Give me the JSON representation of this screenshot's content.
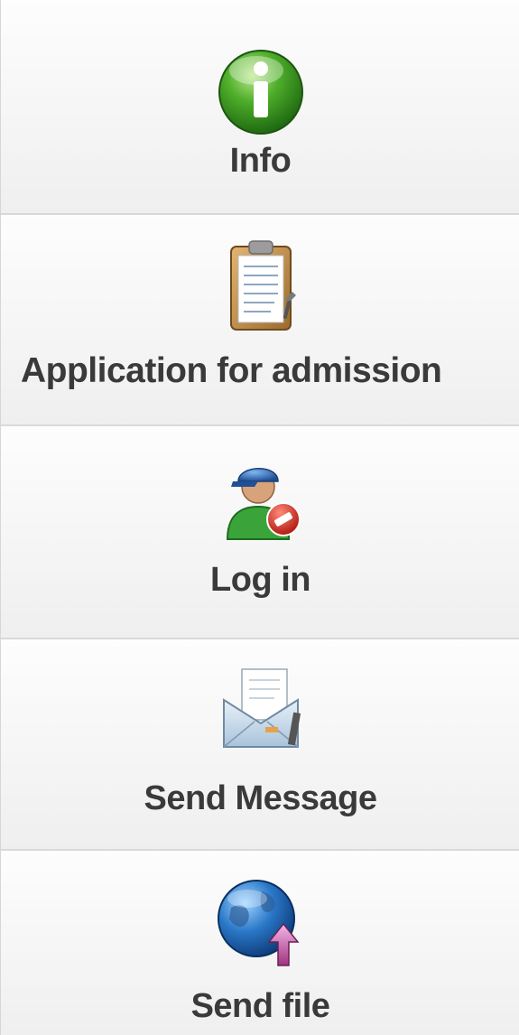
{
  "menu": {
    "items": [
      {
        "label": "Info",
        "icon": "info-icon",
        "accent": "#3a8e1e"
      },
      {
        "label": "Application for admission",
        "icon": "clipboard-icon",
        "accent": "#b07a3a"
      },
      {
        "label": "Log in",
        "icon": "user-login-icon",
        "accent": "#2f6db8"
      },
      {
        "label": "Send Message",
        "icon": "envelope-icon",
        "accent": "#7fa3c4"
      },
      {
        "label": "Send file",
        "icon": "globe-upload-icon",
        "accent": "#1f6fb2"
      }
    ]
  }
}
